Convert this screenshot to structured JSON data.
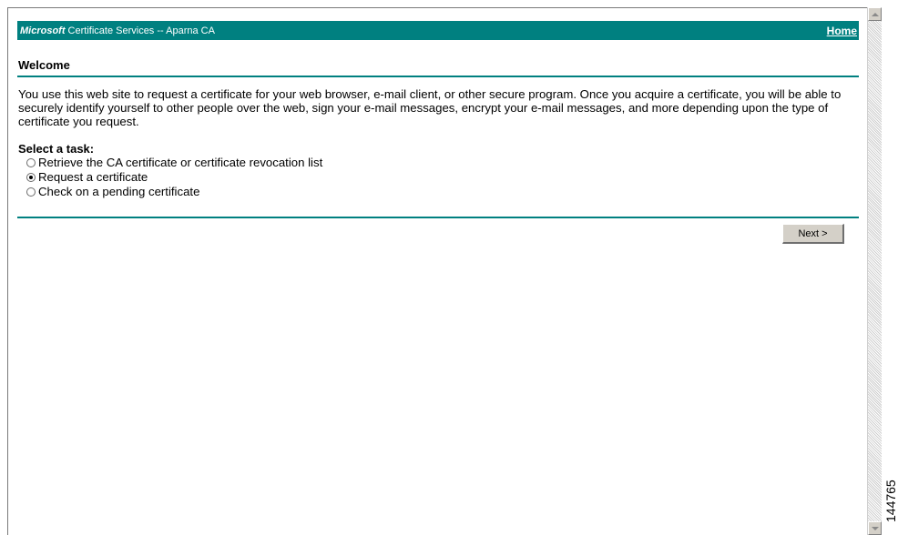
{
  "header": {
    "brand": "Microsoft",
    "title": " Certificate Services  --  Aparna CA",
    "home_link": "Home"
  },
  "welcome": {
    "heading": "Welcome",
    "intro": "You use this web site to request a certificate for your web browser, e-mail client, or other secure program. Once you acquire a certificate, you will be able to securely identify yourself to other people over the web, sign your e-mail messages, encrypt your e-mail messages, and more depending upon the type of certificate you request."
  },
  "tasks": {
    "title": "Select a task:",
    "options": [
      {
        "label": "Retrieve the CA certificate or certificate revocation list",
        "selected": false
      },
      {
        "label": "Request a certificate",
        "selected": true
      },
      {
        "label": "Check on a pending certificate",
        "selected": false
      }
    ]
  },
  "actions": {
    "next_label": "Next >"
  },
  "figure_number": "144765",
  "colors": {
    "accent": "#008080",
    "button_face": "#d4d0c8"
  },
  "icons": {
    "scroll_up": "chevron-up-icon",
    "scroll_down": "chevron-down-icon",
    "radio": "radio-button-icon"
  }
}
